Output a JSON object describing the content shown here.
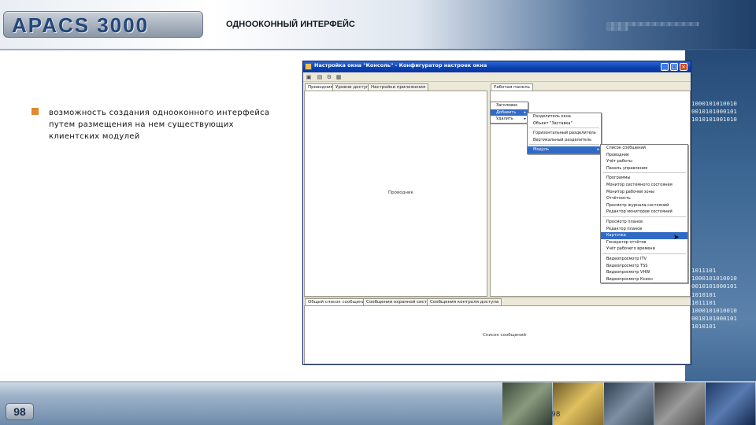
{
  "header": {
    "logo": "APACS 3000",
    "title": "ОДНООКОННЫЙ ИНТЕРФЕЙС"
  },
  "bullet": {
    "text": "возможность создания однооконного интерфейса путем размещения на нем существующих клиентских модулей"
  },
  "decor": {
    "binary_lines_top": [
      "1000101010010",
      "0010101000101",
      "1010101001010"
    ],
    "binary_lines_bottom": [
      "1011101",
      "1000101010010",
      "0010101000101",
      "1010101",
      "1011101",
      "1000101010010",
      "0010101000101",
      "1010101"
    ]
  },
  "footer": {
    "page_number": "98",
    "page_number_ghost": "98"
  },
  "app": {
    "title": "Настройка окна \"Консоль\" - Конфигуратор настроек окна",
    "toolbar_icons": [
      "window-icon",
      "save-icon",
      "options-icon",
      "grid-icon"
    ],
    "top_left_tabs": [
      "Проводник",
      "Уровни доступа",
      "Настройки приложения"
    ],
    "top_right_tab": "Рабочая панель",
    "bottom_tabs": [
      "Общий список сообщений",
      "Сообщения охранной системы",
      "Сообщения контроля доступа"
    ],
    "left_pane_label": "Проводник",
    "bottom_pane_label": "Список сообщений",
    "menu_level1": [
      {
        "label": "Заголовок",
        "has_submenu": false,
        "highlighted": false
      },
      {
        "label": "Добавить",
        "has_submenu": true,
        "highlighted": true
      },
      {
        "label": "Удалить",
        "has_submenu": true,
        "highlighted": false
      }
    ],
    "menu_level2": [
      {
        "label": "Разделитель окна",
        "has_submenu": false,
        "highlighted": false
      },
      {
        "label": "Объект \"Заставка\"",
        "has_submenu": false,
        "highlighted": false
      },
      {
        "separator": true
      },
      {
        "label": "Горизонтальный разделитель",
        "has_submenu": false,
        "highlighted": false
      },
      {
        "label": "Вертикальный разделитель",
        "has_submenu": false,
        "highlighted": false
      },
      {
        "separator": true
      },
      {
        "label": "Модуль",
        "has_submenu": true,
        "highlighted": true
      }
    ],
    "menu_level3": [
      {
        "label": "Список сообщений",
        "highlighted": false
      },
      {
        "label": "Проводник",
        "highlighted": false
      },
      {
        "label": "Учёт работы",
        "highlighted": false
      },
      {
        "label": "Панель управления",
        "highlighted": false
      },
      {
        "separator": true
      },
      {
        "label": "Программы",
        "highlighted": false
      },
      {
        "label": "Монитор системного состояния",
        "highlighted": false
      },
      {
        "label": "Монитор рабочей зоны",
        "highlighted": false
      },
      {
        "label": "Отчётность",
        "highlighted": false
      },
      {
        "label": "Просмотр журнала состояний",
        "highlighted": false
      },
      {
        "label": "Редактор мониторов состояний",
        "highlighted": false
      },
      {
        "separator": true
      },
      {
        "label": "Просмотр планов",
        "highlighted": false
      },
      {
        "label": "Редактор планов",
        "highlighted": false
      },
      {
        "label": "Карточка",
        "highlighted": true
      },
      {
        "label": "Генератор отчётов",
        "highlighted": false
      },
      {
        "label": "Учёт рабочего времени",
        "highlighted": false
      },
      {
        "separator": true
      },
      {
        "label": "Видеопросмотр ITV",
        "highlighted": false
      },
      {
        "label": "Видеопросмотр TSS",
        "highlighted": false
      },
      {
        "label": "Видеопросмотр VHW",
        "highlighted": false
      },
      {
        "label": "Видеопросмотр Ксеон",
        "highlighted": false
      }
    ]
  },
  "colors": {
    "accent_orange": "#e08a32",
    "menu_highlight": "#316ac5",
    "xp_titlebar": "#0a3fb0"
  }
}
